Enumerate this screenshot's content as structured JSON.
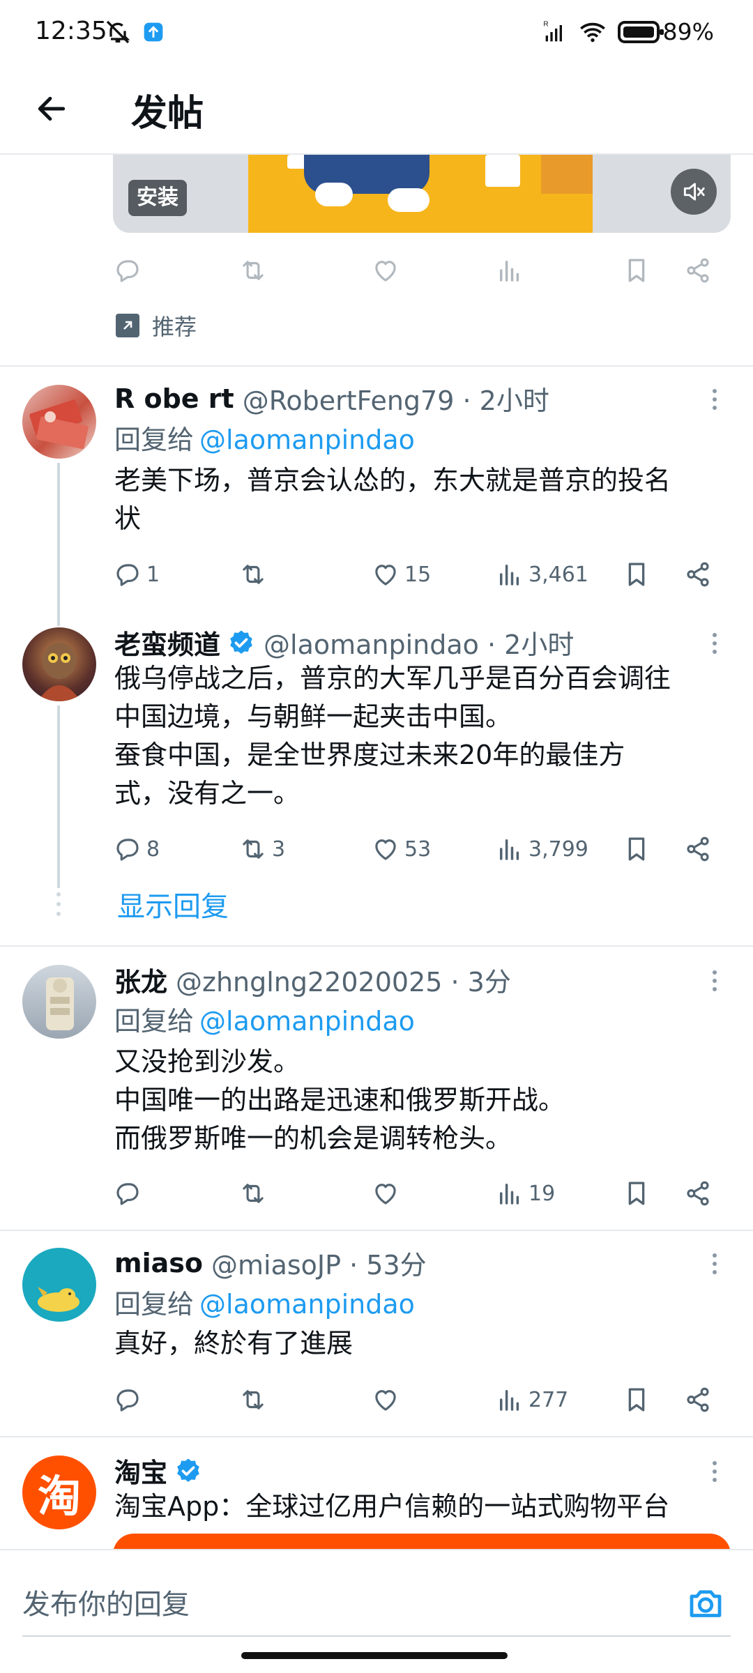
{
  "status_bar": {
    "time": "12:35",
    "battery": "89%"
  },
  "header": {
    "title": "发帖"
  },
  "ad_top": {
    "install_label": "安装",
    "promoted_label": "推荐"
  },
  "tweets": [
    {
      "name": "R obe rt",
      "handle": "@RobertFeng79 · 2小时",
      "reply_prefix": "回复给",
      "reply_mention": "@laomanpindao",
      "lines": [
        "老美下场，普京会认怂的，东大就是普京的投名",
        "状"
      ],
      "replies": "1",
      "retweets": "",
      "likes": "15",
      "views": "3,461"
    },
    {
      "name": "老蛮频道",
      "handle": "@laomanpindao · 2小时",
      "lines": [
        "俄乌停战之后，普京的大军几乎是百分百会调往",
        "中国边境，与朝鲜一起夹击中国。",
        "蚕食中国，是全世界度过未来20年的最佳方",
        "式，没有之一。"
      ],
      "replies": "8",
      "retweets": "3",
      "likes": "53",
      "views": "3,799"
    },
    {
      "name": "张龙",
      "handle": "@zhnglng22020025 · 3分",
      "reply_prefix": "回复给",
      "reply_mention": "@laomanpindao",
      "lines": [
        "又没抢到沙发。",
        "中国唯一的出路是迅速和俄罗斯开战。",
        "而俄罗斯唯一的机会是调转枪头。"
      ],
      "replies": "",
      "retweets": "",
      "likes": "",
      "views": "19"
    },
    {
      "name": "miaso",
      "handle": "@miasoJP · 53分",
      "reply_prefix": "回复给",
      "reply_mention": "@laomanpindao",
      "lines": [
        "真好，終於有了進展"
      ],
      "replies": "",
      "retweets": "",
      "likes": "",
      "views": "277"
    }
  ],
  "show_replies": "显示回复",
  "taobao_ad": {
    "name": "淘宝",
    "avatar_glyph": "淘",
    "text": "淘宝App：全球过亿用户信赖的一站式购物平台"
  },
  "composer": {
    "placeholder": "发布你的回复"
  },
  "colors": {
    "accent": "#1d9bf0",
    "taobao": "#ff5000"
  }
}
